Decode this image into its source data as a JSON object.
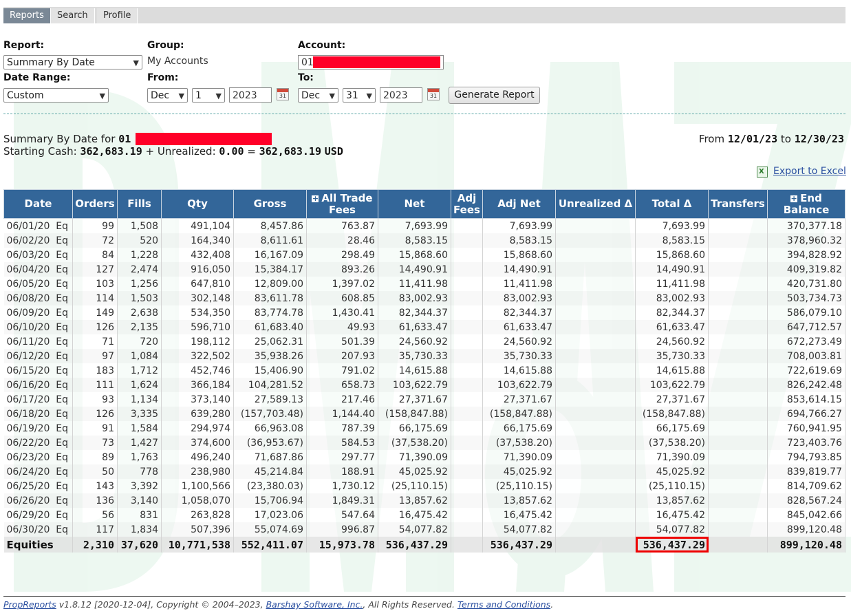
{
  "tabs": [
    "Reports",
    "Search",
    "Profile"
  ],
  "form": {
    "report_label": "Report:",
    "report_value": "Summary By Date",
    "group_label": "Group:",
    "group_value": "My Accounts",
    "account_label": "Account:",
    "account_prefix": "01",
    "date_range_label": "Date Range:",
    "date_range_value": "Custom",
    "from_label": "From:",
    "from_month": "Dec",
    "from_day": "1",
    "from_year": "2023",
    "to_label": "To:",
    "to_month": "Dec",
    "to_day": "31",
    "to_year": "2023",
    "calendar_day": "31",
    "generate_button": "Generate Report"
  },
  "summary": {
    "title_prefix": "Summary By Date for",
    "account_prefix": "01",
    "starting_cash_label": "Starting Cash:",
    "starting_cash": "362,683.19",
    "unrealized_label": "+ Unrealized:",
    "unrealized": "0.00",
    "equals": "=",
    "total": "362,683.19",
    "currency": "USD",
    "from_label": "From",
    "from_date": "12/01/23",
    "to_label": "to",
    "to_date": "12/30/23",
    "export_label": "Export to Excel"
  },
  "table": {
    "headers": [
      "Date",
      "Orders",
      "Fills",
      "Qty",
      "Gross",
      "All Trade Fees",
      "Net",
      "Adj Fees",
      "Adj Net",
      "Unrealized Δ",
      "Total Δ",
      "Transfers",
      "End Balance"
    ],
    "expandable_headers": [
      "All Trade Fees",
      "End Balance"
    ],
    "rows": [
      [
        "06/01/20",
        "Eq",
        "99",
        "1,508",
        "491,104",
        "8,457.86",
        "763.87",
        "7,693.99",
        "",
        "7,693.99",
        "",
        "7,693.99",
        "",
        "370,377.18"
      ],
      [
        "06/02/20",
        "Eq",
        "72",
        "520",
        "164,340",
        "8,611.61",
        "28.46",
        "8,583.15",
        "",
        "8,583.15",
        "",
        "8,583.15",
        "",
        "378,960.32"
      ],
      [
        "06/03/20",
        "Eq",
        "84",
        "1,228",
        "432,408",
        "16,167.09",
        "298.49",
        "15,868.60",
        "",
        "15,868.60",
        "",
        "15,868.60",
        "",
        "394,828.92"
      ],
      [
        "06/04/20",
        "Eq",
        "127",
        "2,474",
        "916,050",
        "15,384.17",
        "893.26",
        "14,490.91",
        "",
        "14,490.91",
        "",
        "14,490.91",
        "",
        "409,319.82"
      ],
      [
        "06/05/20",
        "Eq",
        "103",
        "1,256",
        "647,810",
        "12,809.00",
        "1,397.02",
        "11,411.98",
        "",
        "11,411.98",
        "",
        "11,411.98",
        "",
        "420,731.80"
      ],
      [
        "06/08/20",
        "Eq",
        "114",
        "1,503",
        "302,148",
        "83,611.78",
        "608.85",
        "83,002.93",
        "",
        "83,002.93",
        "",
        "83,002.93",
        "",
        "503,734.73"
      ],
      [
        "06/09/20",
        "Eq",
        "149",
        "2,638",
        "534,350",
        "83,774.78",
        "1,430.41",
        "82,344.37",
        "",
        "82,344.37",
        "",
        "82,344.37",
        "",
        "586,079.10"
      ],
      [
        "06/10/20",
        "Eq",
        "126",
        "2,135",
        "596,710",
        "61,683.40",
        "49.93",
        "61,633.47",
        "",
        "61,633.47",
        "",
        "61,633.47",
        "",
        "647,712.57"
      ],
      [
        "06/11/20",
        "Eq",
        "71",
        "720",
        "198,112",
        "25,062.31",
        "501.39",
        "24,560.92",
        "",
        "24,560.92",
        "",
        "24,560.92",
        "",
        "672,273.49"
      ],
      [
        "06/12/20",
        "Eq",
        "97",
        "1,084",
        "322,502",
        "35,938.26",
        "207.93",
        "35,730.33",
        "",
        "35,730.33",
        "",
        "35,730.33",
        "",
        "708,003.81"
      ],
      [
        "06/15/20",
        "Eq",
        "183",
        "1,712",
        "452,746",
        "15,406.90",
        "791.02",
        "14,615.88",
        "",
        "14,615.88",
        "",
        "14,615.88",
        "",
        "722,619.69"
      ],
      [
        "06/16/20",
        "Eq",
        "111",
        "1,624",
        "366,184",
        "104,281.52",
        "658.73",
        "103,622.79",
        "",
        "103,622.79",
        "",
        "103,622.79",
        "",
        "826,242.48"
      ],
      [
        "06/17/20",
        "Eq",
        "93",
        "1,134",
        "373,140",
        "27,589.13",
        "217.46",
        "27,371.67",
        "",
        "27,371.67",
        "",
        "27,371.67",
        "",
        "853,614.15"
      ],
      [
        "06/18/20",
        "Eq",
        "126",
        "3,335",
        "639,280",
        "(157,703.48)",
        "1,144.40",
        "(158,847.88)",
        "",
        "(158,847.88)",
        "",
        "(158,847.88)",
        "",
        "694,766.27"
      ],
      [
        "06/19/20",
        "Eq",
        "91",
        "1,584",
        "294,974",
        "66,963.08",
        "787.39",
        "66,175.69",
        "",
        "66,175.69",
        "",
        "66,175.69",
        "",
        "760,941.95"
      ],
      [
        "06/22/20",
        "Eq",
        "73",
        "1,427",
        "374,600",
        "(36,953.67)",
        "584.53",
        "(37,538.20)",
        "",
        "(37,538.20)",
        "",
        "(37,538.20)",
        "",
        "723,403.76"
      ],
      [
        "06/23/20",
        "Eq",
        "89",
        "1,763",
        "496,240",
        "71,687.86",
        "297.77",
        "71,390.09",
        "",
        "71,390.09",
        "",
        "71,390.09",
        "",
        "794,793.85"
      ],
      [
        "06/24/20",
        "Eq",
        "50",
        "778",
        "238,980",
        "45,214.84",
        "188.91",
        "45,025.92",
        "",
        "45,025.92",
        "",
        "45,025.92",
        "",
        "839,819.77"
      ],
      [
        "06/25/20",
        "Eq",
        "143",
        "3,392",
        "1,100,566",
        "(23,380.03)",
        "1,730.12",
        "(25,110.15)",
        "",
        "(25,110.15)",
        "",
        "(25,110.15)",
        "",
        "814,709.62"
      ],
      [
        "06/26/20",
        "Eq",
        "136",
        "3,140",
        "1,058,070",
        "15,706.94",
        "1,849.31",
        "13,857.62",
        "",
        "13,857.62",
        "",
        "13,857.62",
        "",
        "828,567.24"
      ],
      [
        "06/29/20",
        "Eq",
        "56",
        "831",
        "263,828",
        "17,023.06",
        "547.64",
        "16,475.42",
        "",
        "16,475.42",
        "",
        "16,475.42",
        "",
        "845,042.66"
      ],
      [
        "06/30/20",
        "Eq",
        "117",
        "1,834",
        "507,396",
        "55,074.69",
        "996.87",
        "54,077.82",
        "",
        "54,077.82",
        "",
        "54,077.82",
        "",
        "899,120.48"
      ]
    ],
    "totals": [
      "Equities",
      "2,310",
      "37,620",
      "10,771,538",
      "552,411.07",
      "15,973.78",
      "536,437.29",
      "",
      "536,437.29",
      "",
      "536,437.29",
      "",
      "899,120.48"
    ]
  },
  "footer": {
    "brand": "PropReports",
    "version": " v1.8.12 [2020-12-04], Copyright © 2004–2023, ",
    "company": "Barshay Software, Inc.",
    "rights": ", All Rights Reserved. ",
    "terms": "Terms and Conditions",
    "end": "."
  },
  "colors": {
    "header_bg": "#336699",
    "highlight": "#e00000",
    "redaction": "#ff0028",
    "active_tab": "#7a8896"
  }
}
